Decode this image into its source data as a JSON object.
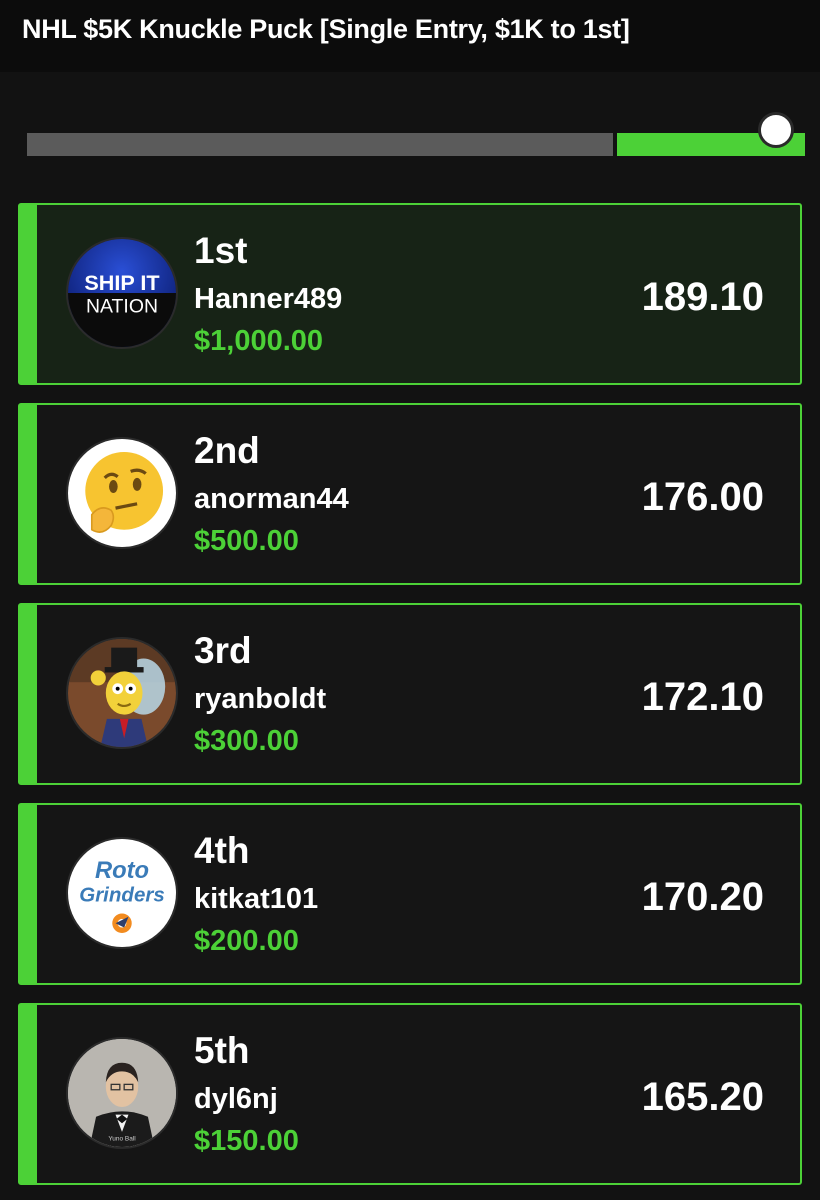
{
  "header": {
    "title": "NHL $5K Knuckle Puck [Single Entry, $1K to 1st]"
  },
  "slider": {
    "progress": 0.24
  },
  "avatars": {
    "ship_it_nation": {
      "line1": "SHIP IT",
      "line2": "NATION"
    },
    "rotogrinders": {
      "line1": "Roto",
      "line2": "Grinders"
    },
    "dyl6nj": {
      "caption": "Yuno Ball"
    }
  },
  "entries": [
    {
      "rank": "1st",
      "username": "Hanner489",
      "prize": "$1,000.00",
      "score": "189.10",
      "avatar": "ship-it-nation-logo"
    },
    {
      "rank": "2nd",
      "username": "anorman44",
      "prize": "$500.00",
      "score": "176.00",
      "avatar": "thinking-face-emoji"
    },
    {
      "rank": "3rd",
      "username": "ryanboldt",
      "prize": "$300.00",
      "score": "172.10",
      "avatar": "cartoon-character"
    },
    {
      "rank": "4th",
      "username": "kitkat101",
      "prize": "$200.00",
      "score": "170.20",
      "avatar": "rotogrinders-logo"
    },
    {
      "rank": "5th",
      "username": "dyl6nj",
      "prize": "$150.00",
      "score": "165.20",
      "avatar": "person-photo"
    }
  ],
  "colors": {
    "accent": "#4cd137",
    "background": "#121212",
    "card_highlight": "#172316"
  }
}
